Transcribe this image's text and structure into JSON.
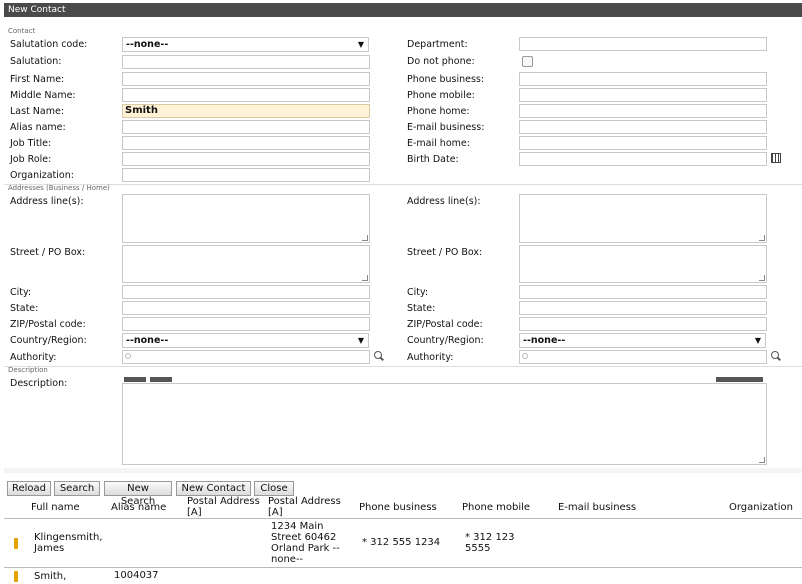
{
  "window": {
    "title": "New Contact"
  },
  "sections": {
    "contact": "Contact",
    "addresses": "Addresses (Business / Home)",
    "description": "Description"
  },
  "contact": {
    "salutation_code": {
      "label": "Salutation code:",
      "value": "--none--"
    },
    "salutation": {
      "label": "Salutation:",
      "value": ""
    },
    "first_name": {
      "label": "First Name:",
      "value": ""
    },
    "middle_name": {
      "label": "Middle Name:",
      "value": ""
    },
    "last_name": {
      "label": "Last Name:",
      "value": "Smith"
    },
    "alias_name": {
      "label": "Alias name:",
      "value": ""
    },
    "job_title": {
      "label": "Job Title:",
      "value": ""
    },
    "job_role": {
      "label": "Job Role:",
      "value": ""
    },
    "organization": {
      "label": "Organization:",
      "value": ""
    },
    "department": {
      "label": "Department:",
      "value": ""
    },
    "do_not_phone": {
      "label": "Do not phone:",
      "checked": false
    },
    "phone_business": {
      "label": "Phone business:",
      "value": ""
    },
    "phone_mobile": {
      "label": "Phone mobile:",
      "value": ""
    },
    "phone_home": {
      "label": "Phone home:",
      "value": ""
    },
    "email_business": {
      "label": "E-mail business:",
      "value": ""
    },
    "email_home": {
      "label": "E-mail home:",
      "value": ""
    },
    "birth_date": {
      "label": "Birth Date:",
      "value": ""
    }
  },
  "addresses": {
    "left": {
      "address_lines": "Address line(s):",
      "street": "Street / PO Box:",
      "city": "City:",
      "state": "State:",
      "zip": "ZIP/Postal code:",
      "country": "Country/Region:",
      "country_value": "--none--",
      "authority": "Authority:"
    },
    "right": {
      "address_lines": "Address line(s):",
      "street": "Street / PO Box:",
      "city": "City:",
      "state": "State:",
      "zip": "ZIP/Postal code:",
      "country": "Country/Region:",
      "country_value": "--none--",
      "authority": "Authority:"
    }
  },
  "description": {
    "label": "Description:",
    "value": ""
  },
  "buttons": {
    "reload": "Reload",
    "search": "Search",
    "new_search": "New Search",
    "new_contact": "New Contact",
    "close": "Close"
  },
  "table": {
    "headers": [
      "Full name",
      "Alias name",
      "Postal Address [A]",
      "Postal Address [A]",
      "Phone business",
      "Phone mobile",
      "E-mail business",
      "Organization"
    ],
    "rows": [
      {
        "full_name": "Klingensmith, James",
        "alias": "",
        "postal1": "",
        "postal2": "1234 Main Street 60462 Orland Park -- none--",
        "phone_business": "* 312 555 1234",
        "phone_mobile": "* 312 123 5555",
        "email": "",
        "org": ""
      },
      {
        "full_name": "Smith,",
        "alias": "1004037",
        "postal1": "",
        "postal2": "",
        "phone_business": "",
        "phone_mobile": "",
        "email": "",
        "org": ""
      }
    ]
  }
}
